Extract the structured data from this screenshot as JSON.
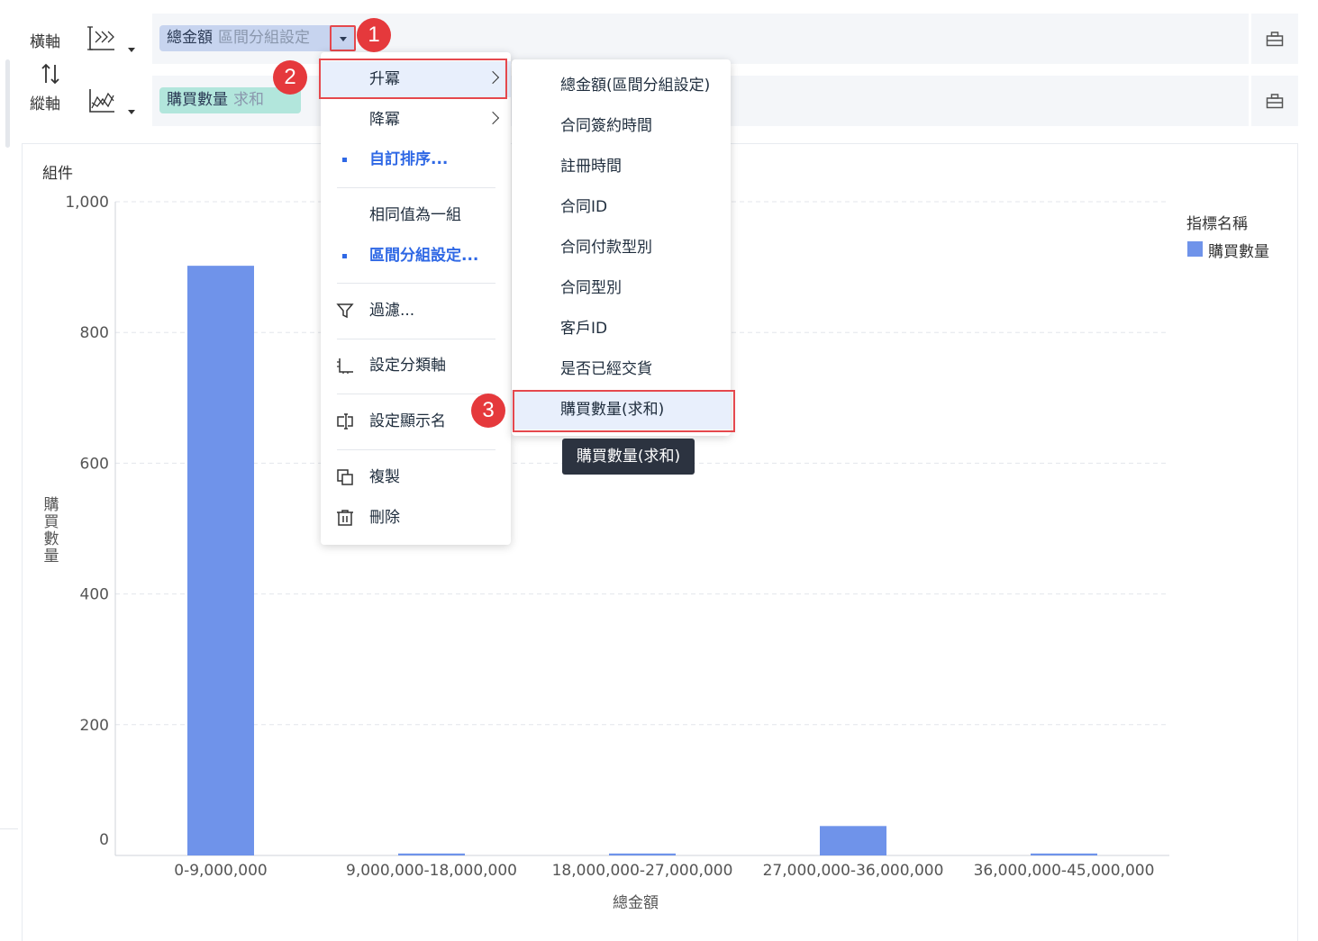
{
  "axes": {
    "horizontal": {
      "label": "橫軸",
      "chart_icon": "horizontal-axis-icon",
      "pill_main": "總金額",
      "pill_sub": "區間分組設定"
    },
    "vertical": {
      "label": "縱軸",
      "chart_icon": "line-chart-icon",
      "pill_main": "購買數量",
      "pill_sub": "求和"
    },
    "swap_icon": "swap-icon",
    "end_icon": "toolbox-icon"
  },
  "chart_panel": {
    "component_title": "組件",
    "legend_title": "指標名稱"
  },
  "context_menu": {
    "items": [
      {
        "label": "升冪",
        "has_submenu": true
      },
      {
        "label": "降冪",
        "has_submenu": true
      },
      {
        "label": "自訂排序..."
      },
      {
        "label": "相同值為一組"
      },
      {
        "label": "區間分組設定..."
      },
      {
        "label": "過濾...",
        "icon": "filter-icon"
      },
      {
        "label": "設定分類軸",
        "icon": "axis-icon"
      },
      {
        "label": "設定顯示名",
        "icon": "rename-icon"
      },
      {
        "label": "複製",
        "icon": "copy-icon"
      },
      {
        "label": "刪除",
        "icon": "trash-icon"
      }
    ]
  },
  "submenu": {
    "items": [
      "總金額(區間分組設定)",
      "合同簽約時間",
      "註冊時間",
      "合同ID",
      "合同付款型別",
      "合同型別",
      "客戶ID",
      "是否已經交貨",
      "購買數量(求和)"
    ]
  },
  "tooltip": "購買數量(求和)",
  "badges": [
    "1",
    "2",
    "3"
  ],
  "chart_data": {
    "type": "bar",
    "categories": [
      "0-9,000,000",
      "9,000,000-18,000,000",
      "18,000,000-27,000,000",
      "27,000,000-36,000,000",
      "36,000,000-45,000,000"
    ],
    "series": [
      {
        "name": "購買數量",
        "values": [
          902,
          3,
          3,
          45,
          3
        ],
        "color": "#6f93ea"
      }
    ],
    "xlabel": "總金額",
    "ylabel": "購買數量",
    "ylim": [
      0,
      1000
    ],
    "yticks": [
      0,
      200,
      400,
      600,
      800,
      1000
    ],
    "ytick_labels": [
      "0",
      "200",
      "400",
      "600",
      "800",
      "1,000"
    ],
    "grid": true,
    "legend": "top-right"
  }
}
